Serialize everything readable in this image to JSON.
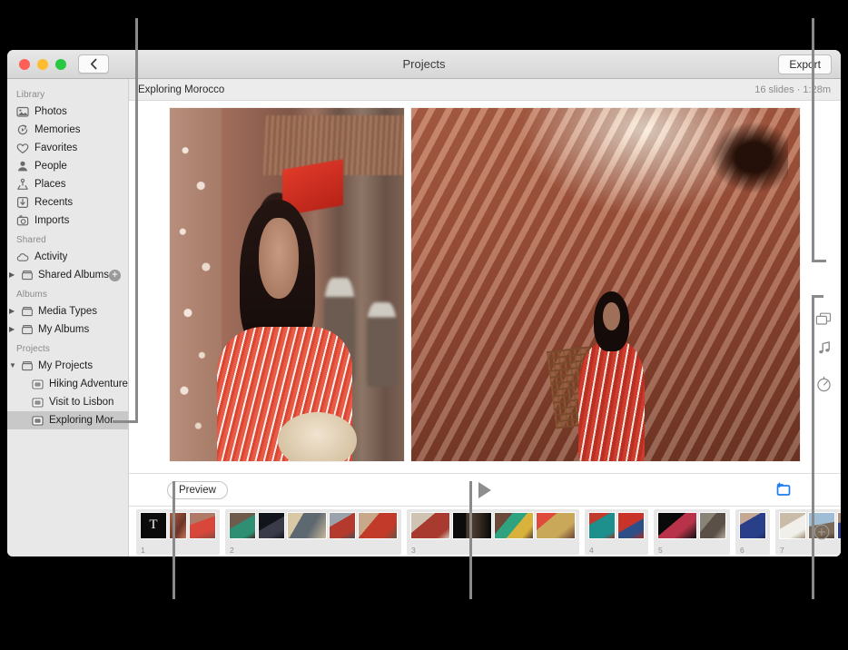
{
  "window": {
    "title": "Projects",
    "back_label": "‹",
    "export_label": "Export",
    "traffic_lights": [
      "close-red",
      "minimize-yellow",
      "zoom-green"
    ]
  },
  "sidebar": {
    "sections": [
      {
        "header": "Library",
        "items": [
          {
            "label": "Photos",
            "icon": "photos-icon"
          },
          {
            "label": "Memories",
            "icon": "memories-icon"
          },
          {
            "label": "Favorites",
            "icon": "heart-icon"
          },
          {
            "label": "People",
            "icon": "person-icon"
          },
          {
            "label": "Places",
            "icon": "pin-icon"
          },
          {
            "label": "Recents",
            "icon": "download-icon"
          },
          {
            "label": "Imports",
            "icon": "imports-icon"
          }
        ]
      },
      {
        "header": "Shared",
        "items": [
          {
            "label": "Activity",
            "icon": "cloud-icon"
          },
          {
            "label": "Shared Albums",
            "icon": "album-icon",
            "disclosure": "▶",
            "trailing": "add-shared-album-button"
          }
        ]
      },
      {
        "header": "Albums",
        "items": [
          {
            "label": "Media Types",
            "icon": "album-icon",
            "disclosure": "▶"
          },
          {
            "label": "My Albums",
            "icon": "album-icon",
            "disclosure": "▶"
          }
        ]
      },
      {
        "header": "Projects",
        "items": [
          {
            "label": "My Projects",
            "icon": "album-icon",
            "disclosure": "▼"
          },
          {
            "label": "Hiking Adventure",
            "icon": "project-icon",
            "indent": true
          },
          {
            "label": "Visit to Lisbon",
            "icon": "project-icon",
            "indent": true
          },
          {
            "label": "Exploring Moroc...",
            "icon": "project-icon",
            "indent": true,
            "selected": true
          }
        ]
      }
    ]
  },
  "project": {
    "name": "Exploring Morocco",
    "meta": "16 slides · 1:28m"
  },
  "toolbar": {
    "preview_label": "Preview",
    "play_label": "play-button",
    "add_slide_label": "add-slide-button",
    "accent_color": "#1a7df5"
  },
  "rail": {
    "icons": [
      {
        "name": "slides-icon",
        "title": "Slides"
      },
      {
        "name": "music-note-icon",
        "title": "Music"
      },
      {
        "name": "duration-timer-icon",
        "title": "Duration"
      }
    ]
  },
  "filmstrip": {
    "add_button": "+",
    "groups": [
      {
        "number": "1",
        "slides": [
          "title-slide-T",
          "alley-wall-photo",
          "red-dress-photo"
        ]
      },
      {
        "number": "2",
        "slides": [
          "green-dress-photo",
          "man-cap-photo",
          "market-boy-photo",
          "red-shirt-boy-photo",
          "red-top-woman-photo"
        ]
      },
      {
        "number": "3",
        "slides": [
          "woman-red-dress-photo",
          "dark-doorway-photo",
          "crowd-colorful-photo",
          "gold-dress-woman-photo"
        ]
      },
      {
        "number": "4",
        "slides": [
          "teal-shirt-photo",
          "red-curtain-photo"
        ]
      },
      {
        "number": "5",
        "slides": [
          "night-singer-photo",
          "street-market-photo"
        ]
      },
      {
        "number": "6",
        "slides": [
          "blue-dress-woman-photo"
        ]
      },
      {
        "number": "7",
        "slides": [
          "white-robe-photo",
          "rooftop-photo",
          "blue-dress-crop-photo"
        ]
      }
    ]
  },
  "slide_preview": {
    "left_image": "alley-portrait-photo",
    "right_image": "sunlit-wall-photo"
  },
  "callouts": {
    "color": "#8a8a8a",
    "lines": [
      "sidebar-selected-project",
      "project-meta-slides",
      "music-duration-rail",
      "preview-button",
      "play-button"
    ]
  }
}
